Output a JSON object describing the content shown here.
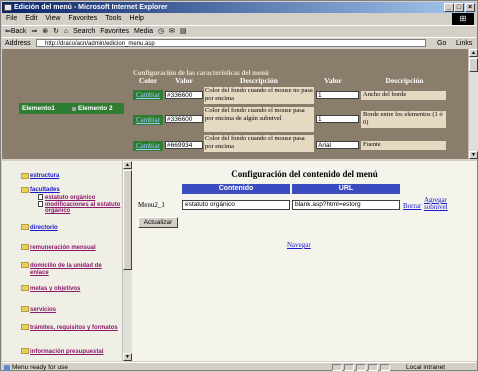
{
  "window": {
    "title": "Edición del menú - Microsoft Internet Explorer",
    "controls": [
      "_",
      "□",
      "×"
    ]
  },
  "menubar": [
    "File",
    "Edit",
    "View",
    "Favorites",
    "Tools",
    "Help"
  ],
  "toolbar": {
    "back": "⇐Back",
    "forward": "⇒",
    "search": "Search",
    "favorites": "Favorites",
    "media": "Media"
  },
  "address": {
    "label": "Address",
    "url": "http://draco/acn/admin/edicion_menu.asp",
    "go": "Go",
    "links": "Links »"
  },
  "config": {
    "title": "Configuración de las características del menú",
    "headers": [
      "Color",
      "Valor",
      "Descripción",
      "Valor",
      "Descripción"
    ],
    "rows": [
      {
        "link": "Cambiar",
        "color": "#336600",
        "desc": "Color del fondo cuando el mouse no pasa por encima",
        "value": "1",
        "desc2": "Ancho del borde"
      },
      {
        "link": "Cambiar",
        "color": "#336600",
        "desc": "Color del fondo cuando el mouse pasa por encima de algún subnivel",
        "value": "1",
        "desc2": "Borde entre los elementos (1 ó 0)"
      },
      {
        "link": "Cambiar",
        "color": "#669934",
        "desc": "Color del fondo cuando el mouse pasa por encima",
        "value": "Arial",
        "desc2": "Fuente"
      }
    ]
  },
  "preview": {
    "item1": "Elemento1",
    "item2": "Elemento 2"
  },
  "nav": [
    {
      "label": "estructura",
      "visited": false
    },
    {
      "label": "facultades",
      "visited": false
    },
    {
      "label": "directorio",
      "visited": false
    },
    {
      "label": "remuneración mensual",
      "visited": true
    },
    {
      "label": "domicilio de la unidad de enlace",
      "visited": true
    },
    {
      "label": "metas y objetivos",
      "visited": true
    },
    {
      "label": "servicios",
      "visited": true
    },
    {
      "label": "trámites, requisitos y formatos",
      "visited": true
    },
    {
      "label": "información presupuestal",
      "visited": true
    }
  ],
  "nav_sub": [
    "estatuto orgánico",
    "modificaciones al estatuto orgánico"
  ],
  "content": {
    "title": "Configuración del contenido del menú",
    "headers": [
      "Contenido",
      "URL"
    ],
    "row_label": "Menu2_1",
    "content_value": "estatuto orgánico",
    "url_value": "blank.asp?html=estorg",
    "delete": "Borrar",
    "add_sub": "Agregar subnivel",
    "update_button": "Actualizar",
    "navigate": "Navegar"
  },
  "status": {
    "message": "Menu ready for use",
    "zone": "Local intranet"
  }
}
